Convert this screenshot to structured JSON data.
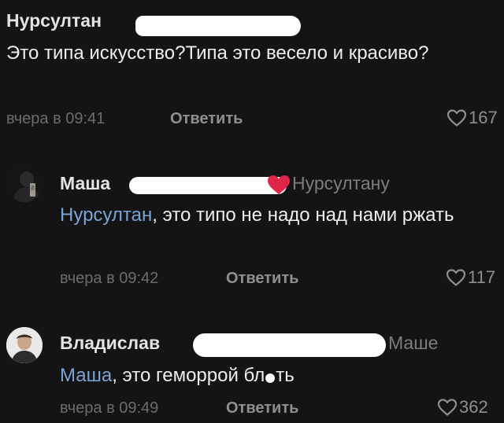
{
  "comments": [
    {
      "author": "Нурсултан",
      "text": "Это типа искусство?Типа это весело и красиво?",
      "time": "вчера в 09:41",
      "reply_label": "Ответить",
      "likes": "167"
    },
    {
      "author": "Маша",
      "reply_to": "Нурсултану",
      "mention": "Нурсултан",
      "text": ", это типо не надо над нами ржать",
      "time": "вчера в 09:42",
      "reply_label": "Ответить",
      "likes": "117"
    },
    {
      "author": "Владислав",
      "reply_to": "Маше",
      "mention": "Маша",
      "text_part1": ", это геморрой бл",
      "text_part2": "ть",
      "time": "вчера в 09:49",
      "reply_label": "Ответить",
      "likes": "362"
    }
  ],
  "icons": {
    "like": "heart-outline-icon",
    "emoji": "red-heart-icon"
  },
  "colors": {
    "background": "#141414",
    "mention": "#7aa3d8",
    "redaction": "#ffffff"
  }
}
